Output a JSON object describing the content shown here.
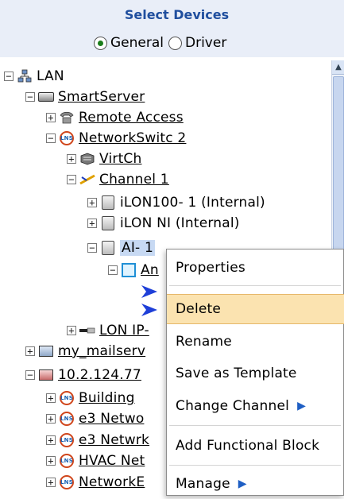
{
  "header": {
    "title": "Select Devices"
  },
  "mode": {
    "options": [
      "General",
      "Driver"
    ],
    "selected": "General"
  },
  "tree": {
    "lan": "LAN",
    "smartserver": "SmartServer",
    "remote_access": "Remote Access",
    "networkswitc": "NetworkSwitc 2",
    "virtch": "VirtCh",
    "channel1": "Channel 1",
    "ilon100": "iLON100- 1 (Internal)",
    "ilonni": "iLON NI (Internal)",
    "ai1": "AI- 1",
    "an": "An",
    "lonip": "LON IP-",
    "mailserv": "my_mailserv",
    "ip": "10.2.124.77",
    "building": "Building",
    "e3netwo": "e3 Netwo",
    "e3netwrk": "e3 Netwrk",
    "hvacnet": "HVAC Net",
    "networke": "NetworkE"
  },
  "context_menu": {
    "items": [
      "Properties",
      "Delete",
      "Rename",
      "Save as Template",
      "Change Channel",
      "Add Functional Block",
      "Manage"
    ],
    "highlighted": "Delete"
  },
  "icons": {
    "scroll_up": "▲"
  }
}
